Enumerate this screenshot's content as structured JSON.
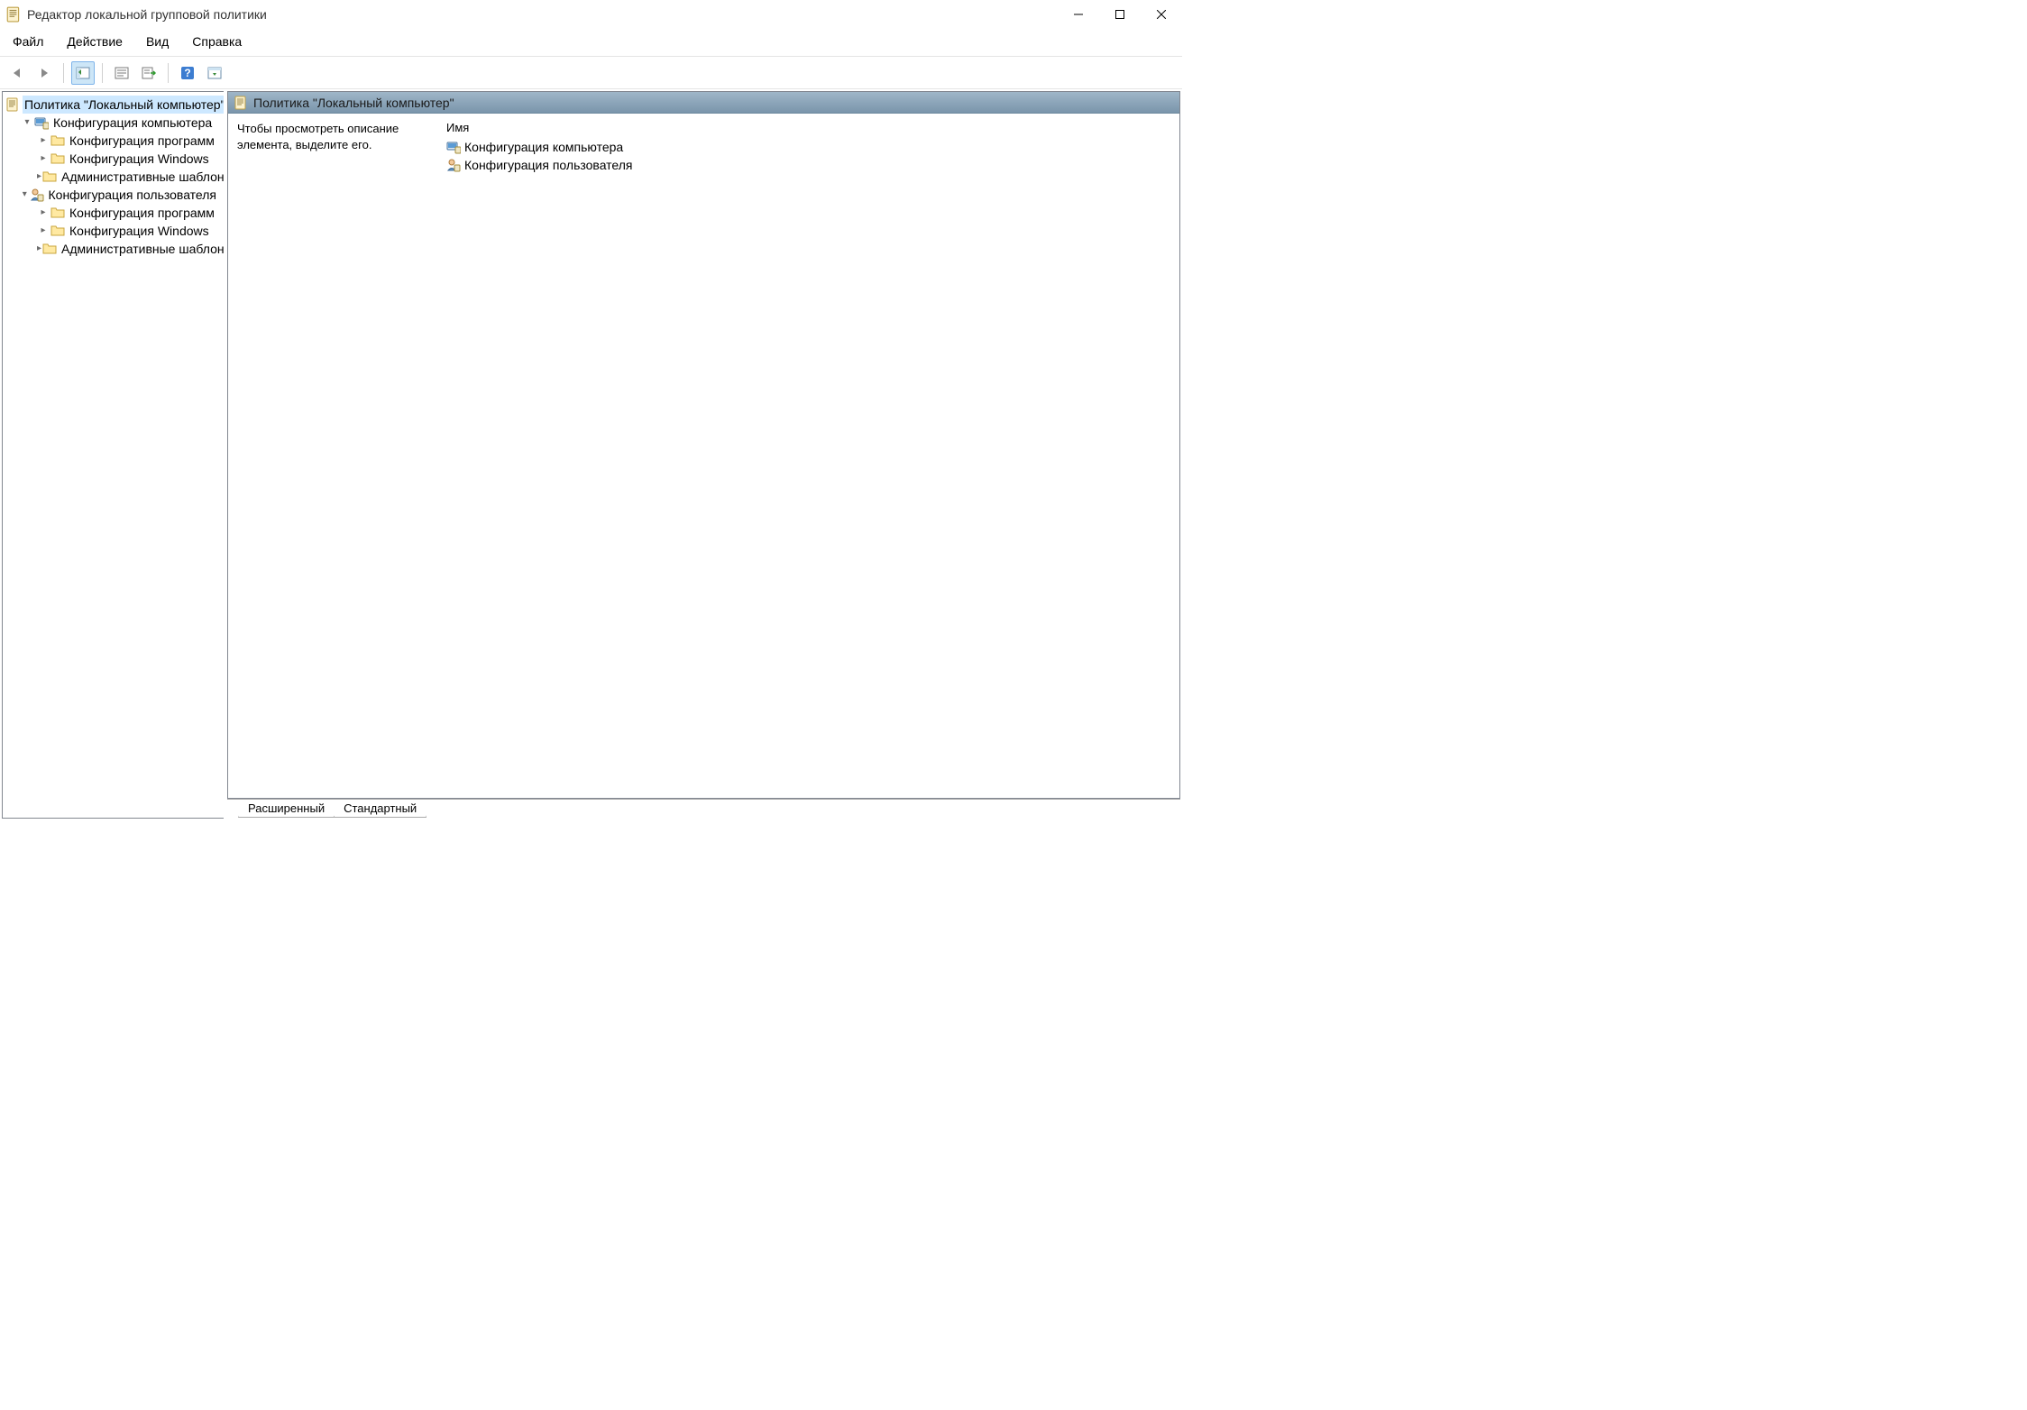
{
  "window": {
    "title": "Редактор локальной групповой политики"
  },
  "menu": {
    "items": [
      "Файл",
      "Действие",
      "Вид",
      "Справка"
    ]
  },
  "toolbar": {
    "icons": [
      "back",
      "forward",
      "sep",
      "detail-pane",
      "sep",
      "properties",
      "export-list",
      "sep",
      "help",
      "show-hide"
    ]
  },
  "tree": {
    "root": {
      "label": "Политика \"Локальный компьютер\"",
      "icon": "policy-doc",
      "selected": true,
      "children": [
        {
          "label": "Конфигурация компьютера",
          "icon": "computer-config",
          "expanded": true,
          "children": [
            {
              "label": "Конфигурация программ",
              "icon": "folder"
            },
            {
              "label": "Конфигурация Windows",
              "icon": "folder"
            },
            {
              "label": "Административные шаблоны",
              "icon": "folder"
            }
          ]
        },
        {
          "label": "Конфигурация пользователя",
          "icon": "user-config",
          "expanded": true,
          "children": [
            {
              "label": "Конфигурация программ",
              "icon": "folder"
            },
            {
              "label": "Конфигурация Windows",
              "icon": "folder"
            },
            {
              "label": "Административные шаблоны",
              "icon": "folder"
            }
          ]
        }
      ]
    }
  },
  "content": {
    "header": "Политика \"Локальный компьютер\"",
    "description": "Чтобы просмотреть описание элемента, выделите его.",
    "column_name": "Имя",
    "items": [
      {
        "label": "Конфигурация компьютера",
        "icon": "computer-config"
      },
      {
        "label": "Конфигурация пользователя",
        "icon": "user-config"
      }
    ]
  },
  "tabs": {
    "items": [
      "Расширенный",
      "Стандартный"
    ],
    "active": 0
  }
}
